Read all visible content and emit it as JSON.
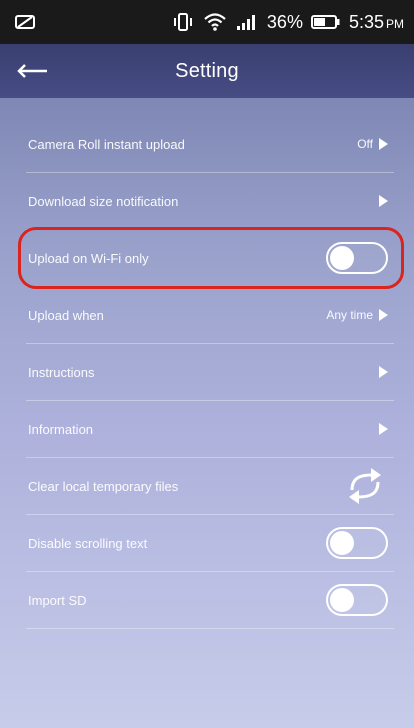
{
  "status_bar": {
    "battery_percent": "36%",
    "time": "5:35",
    "time_suffix": "PM"
  },
  "header": {
    "title": "Setting"
  },
  "settings": [
    {
      "label": "Camera Roll instant upload",
      "value": "Off",
      "control": "arrow"
    },
    {
      "label": "Download size notification",
      "value": "",
      "control": "arrow"
    },
    {
      "label": "Upload on Wi-Fi only",
      "control": "toggle",
      "state": "off"
    },
    {
      "label": "Upload when",
      "value": "Any time",
      "control": "arrow"
    },
    {
      "label": "Instructions",
      "value": "",
      "control": "arrow"
    },
    {
      "label": "Information",
      "value": "",
      "control": "arrow"
    },
    {
      "label": "Clear local temporary files",
      "control": "refresh-icon"
    },
    {
      "label": "Disable scrolling text",
      "control": "toggle",
      "state": "off"
    },
    {
      "label": "Import SD",
      "control": "toggle",
      "state": "off"
    }
  ],
  "colors": {
    "header": "#434879",
    "highlight": "#d9241f"
  }
}
